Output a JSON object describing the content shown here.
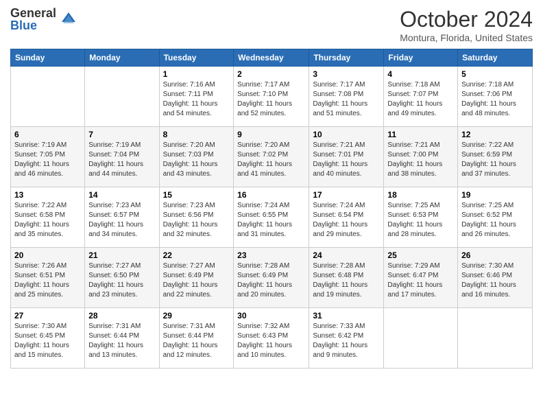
{
  "logo": {
    "general": "General",
    "blue": "Blue"
  },
  "title": "October 2024",
  "location": "Montura, Florida, United States",
  "days_of_week": [
    "Sunday",
    "Monday",
    "Tuesday",
    "Wednesday",
    "Thursday",
    "Friday",
    "Saturday"
  ],
  "weeks": [
    [
      {
        "day": "",
        "sunrise": "",
        "sunset": "",
        "daylight": ""
      },
      {
        "day": "",
        "sunrise": "",
        "sunset": "",
        "daylight": ""
      },
      {
        "day": "1",
        "sunrise": "Sunrise: 7:16 AM",
        "sunset": "Sunset: 7:11 PM",
        "daylight": "Daylight: 11 hours and 54 minutes."
      },
      {
        "day": "2",
        "sunrise": "Sunrise: 7:17 AM",
        "sunset": "Sunset: 7:10 PM",
        "daylight": "Daylight: 11 hours and 52 minutes."
      },
      {
        "day": "3",
        "sunrise": "Sunrise: 7:17 AM",
        "sunset": "Sunset: 7:08 PM",
        "daylight": "Daylight: 11 hours and 51 minutes."
      },
      {
        "day": "4",
        "sunrise": "Sunrise: 7:18 AM",
        "sunset": "Sunset: 7:07 PM",
        "daylight": "Daylight: 11 hours and 49 minutes."
      },
      {
        "day": "5",
        "sunrise": "Sunrise: 7:18 AM",
        "sunset": "Sunset: 7:06 PM",
        "daylight": "Daylight: 11 hours and 48 minutes."
      }
    ],
    [
      {
        "day": "6",
        "sunrise": "Sunrise: 7:19 AM",
        "sunset": "Sunset: 7:05 PM",
        "daylight": "Daylight: 11 hours and 46 minutes."
      },
      {
        "day": "7",
        "sunrise": "Sunrise: 7:19 AM",
        "sunset": "Sunset: 7:04 PM",
        "daylight": "Daylight: 11 hours and 44 minutes."
      },
      {
        "day": "8",
        "sunrise": "Sunrise: 7:20 AM",
        "sunset": "Sunset: 7:03 PM",
        "daylight": "Daylight: 11 hours and 43 minutes."
      },
      {
        "day": "9",
        "sunrise": "Sunrise: 7:20 AM",
        "sunset": "Sunset: 7:02 PM",
        "daylight": "Daylight: 11 hours and 41 minutes."
      },
      {
        "day": "10",
        "sunrise": "Sunrise: 7:21 AM",
        "sunset": "Sunset: 7:01 PM",
        "daylight": "Daylight: 11 hours and 40 minutes."
      },
      {
        "day": "11",
        "sunrise": "Sunrise: 7:21 AM",
        "sunset": "Sunset: 7:00 PM",
        "daylight": "Daylight: 11 hours and 38 minutes."
      },
      {
        "day": "12",
        "sunrise": "Sunrise: 7:22 AM",
        "sunset": "Sunset: 6:59 PM",
        "daylight": "Daylight: 11 hours and 37 minutes."
      }
    ],
    [
      {
        "day": "13",
        "sunrise": "Sunrise: 7:22 AM",
        "sunset": "Sunset: 6:58 PM",
        "daylight": "Daylight: 11 hours and 35 minutes."
      },
      {
        "day": "14",
        "sunrise": "Sunrise: 7:23 AM",
        "sunset": "Sunset: 6:57 PM",
        "daylight": "Daylight: 11 hours and 34 minutes."
      },
      {
        "day": "15",
        "sunrise": "Sunrise: 7:23 AM",
        "sunset": "Sunset: 6:56 PM",
        "daylight": "Daylight: 11 hours and 32 minutes."
      },
      {
        "day": "16",
        "sunrise": "Sunrise: 7:24 AM",
        "sunset": "Sunset: 6:55 PM",
        "daylight": "Daylight: 11 hours and 31 minutes."
      },
      {
        "day": "17",
        "sunrise": "Sunrise: 7:24 AM",
        "sunset": "Sunset: 6:54 PM",
        "daylight": "Daylight: 11 hours and 29 minutes."
      },
      {
        "day": "18",
        "sunrise": "Sunrise: 7:25 AM",
        "sunset": "Sunset: 6:53 PM",
        "daylight": "Daylight: 11 hours and 28 minutes."
      },
      {
        "day": "19",
        "sunrise": "Sunrise: 7:25 AM",
        "sunset": "Sunset: 6:52 PM",
        "daylight": "Daylight: 11 hours and 26 minutes."
      }
    ],
    [
      {
        "day": "20",
        "sunrise": "Sunrise: 7:26 AM",
        "sunset": "Sunset: 6:51 PM",
        "daylight": "Daylight: 11 hours and 25 minutes."
      },
      {
        "day": "21",
        "sunrise": "Sunrise: 7:27 AM",
        "sunset": "Sunset: 6:50 PM",
        "daylight": "Daylight: 11 hours and 23 minutes."
      },
      {
        "day": "22",
        "sunrise": "Sunrise: 7:27 AM",
        "sunset": "Sunset: 6:49 PM",
        "daylight": "Daylight: 11 hours and 22 minutes."
      },
      {
        "day": "23",
        "sunrise": "Sunrise: 7:28 AM",
        "sunset": "Sunset: 6:49 PM",
        "daylight": "Daylight: 11 hours and 20 minutes."
      },
      {
        "day": "24",
        "sunrise": "Sunrise: 7:28 AM",
        "sunset": "Sunset: 6:48 PM",
        "daylight": "Daylight: 11 hours and 19 minutes."
      },
      {
        "day": "25",
        "sunrise": "Sunrise: 7:29 AM",
        "sunset": "Sunset: 6:47 PM",
        "daylight": "Daylight: 11 hours and 17 minutes."
      },
      {
        "day": "26",
        "sunrise": "Sunrise: 7:30 AM",
        "sunset": "Sunset: 6:46 PM",
        "daylight": "Daylight: 11 hours and 16 minutes."
      }
    ],
    [
      {
        "day": "27",
        "sunrise": "Sunrise: 7:30 AM",
        "sunset": "Sunset: 6:45 PM",
        "daylight": "Daylight: 11 hours and 15 minutes."
      },
      {
        "day": "28",
        "sunrise": "Sunrise: 7:31 AM",
        "sunset": "Sunset: 6:44 PM",
        "daylight": "Daylight: 11 hours and 13 minutes."
      },
      {
        "day": "29",
        "sunrise": "Sunrise: 7:31 AM",
        "sunset": "Sunset: 6:44 PM",
        "daylight": "Daylight: 11 hours and 12 minutes."
      },
      {
        "day": "30",
        "sunrise": "Sunrise: 7:32 AM",
        "sunset": "Sunset: 6:43 PM",
        "daylight": "Daylight: 11 hours and 10 minutes."
      },
      {
        "day": "31",
        "sunrise": "Sunrise: 7:33 AM",
        "sunset": "Sunset: 6:42 PM",
        "daylight": "Daylight: 11 hours and 9 minutes."
      },
      {
        "day": "",
        "sunrise": "",
        "sunset": "",
        "daylight": ""
      },
      {
        "day": "",
        "sunrise": "",
        "sunset": "",
        "daylight": ""
      }
    ]
  ]
}
